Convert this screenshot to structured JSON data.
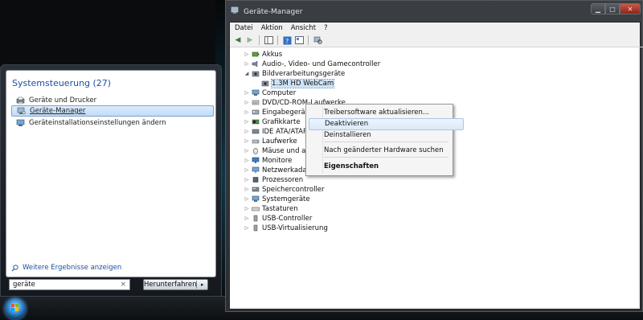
{
  "start_menu": {
    "heading": "Systemsteuerung (27)",
    "items": [
      {
        "label": "Geräte und Drucker"
      },
      {
        "label": "Geräte-Manager"
      },
      {
        "label": "Geräteinstallationseinstellungen ändern"
      }
    ],
    "more_results": "Weitere Ergebnisse anzeigen",
    "search_value": "geräte",
    "search_clear": "×",
    "shutdown_label": "Herunterfahren",
    "shutdown_arrow": "▸"
  },
  "window": {
    "title": "Geräte-Manager",
    "menu": [
      "Datei",
      "Aktion",
      "Ansicht",
      "?"
    ],
    "tree": [
      {
        "label": "Akkus",
        "expander": "▷"
      },
      {
        "label": "Audio-, Video- und Gamecontroller",
        "expander": "▷"
      },
      {
        "label": "Bildverarbeitungsgeräte",
        "expander": "◢"
      },
      {
        "label": "1.3M HD WebCam",
        "expander": ""
      },
      {
        "label": "Computer",
        "expander": "▷"
      },
      {
        "label": "DVD/CD-ROM-Laufwerke",
        "expander": "▷"
      },
      {
        "label": "Eingabegeräte (Human Interface Devices)",
        "expander": "▷"
      },
      {
        "label": "Grafikkarte",
        "expander": "▷"
      },
      {
        "label": "IDE ATA/ATAPI-Controller",
        "expander": "▷"
      },
      {
        "label": "Laufwerke",
        "expander": "▷"
      },
      {
        "label": "Mäuse und andere Zeigegeräte",
        "expander": "▷"
      },
      {
        "label": "Monitore",
        "expander": "▷"
      },
      {
        "label": "Netzwerkadapter",
        "expander": "▷"
      },
      {
        "label": "Prozessoren",
        "expander": "▷"
      },
      {
        "label": "Speichercontroller",
        "expander": "▷"
      },
      {
        "label": "Systemgeräte",
        "expander": "▷"
      },
      {
        "label": "Tastaturen",
        "expander": "▷"
      },
      {
        "label": "USB-Controller",
        "expander": "▷"
      },
      {
        "label": "USB-Virtualisierung",
        "expander": "▷"
      }
    ],
    "context_menu": {
      "items": [
        {
          "label": "Treibersoftware aktualisieren..."
        },
        {
          "label": "Deaktivieren"
        },
        {
          "label": "Deinstallieren"
        },
        {
          "label": "Nach geänderter Hardware suchen"
        },
        {
          "label": "Eigenschaften"
        }
      ]
    }
  },
  "colors": {
    "accent_link": "#1e4fa3",
    "selection": "#c1dcf8",
    "close_button": "#c8584a"
  }
}
